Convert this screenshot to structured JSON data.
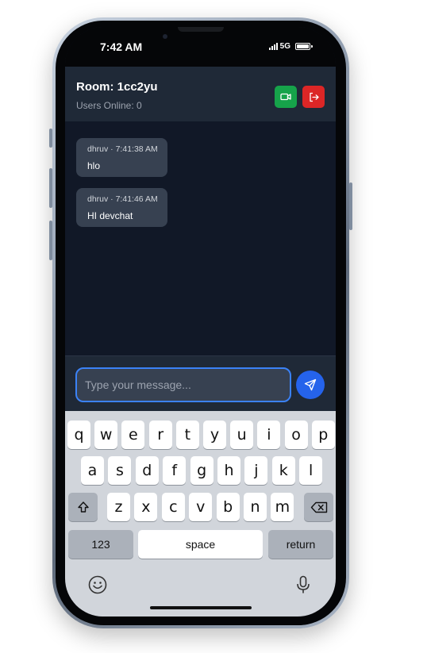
{
  "status_bar": {
    "time": "7:42 AM",
    "network": "5G"
  },
  "header": {
    "room_title": "Room: 1cc2yu",
    "users_online": "Users Online: 0"
  },
  "messages": [
    {
      "meta": "dhruv · 7:41:38 AM",
      "text": "hlo"
    },
    {
      "meta": "dhruv · 7:41:46 AM",
      "text": "HI devchat"
    }
  ],
  "composer": {
    "placeholder": "Type your message...",
    "value": ""
  },
  "keyboard": {
    "row1": [
      "q",
      "w",
      "e",
      "r",
      "t",
      "y",
      "u",
      "i",
      "o",
      "p"
    ],
    "row2": [
      "a",
      "s",
      "d",
      "f",
      "g",
      "h",
      "j",
      "k",
      "l"
    ],
    "row3": [
      "z",
      "x",
      "c",
      "v",
      "b",
      "n",
      "m"
    ],
    "numbers_label": "123",
    "space_label": "space",
    "return_label": "return"
  },
  "colors": {
    "background": "#111827",
    "header": "#1f2937",
    "bubble": "#374151",
    "video_button": "#16a34a",
    "leave_button": "#dc2626",
    "send_button": "#2563eb",
    "input_border": "#3b82f6"
  },
  "icons": {
    "video": "video-camera-icon",
    "leave": "logout-icon",
    "send": "paper-plane-icon",
    "shift": "shift-arrow-icon",
    "backspace": "backspace-icon",
    "emoji": "emoji-icon",
    "mic": "microphone-icon"
  }
}
